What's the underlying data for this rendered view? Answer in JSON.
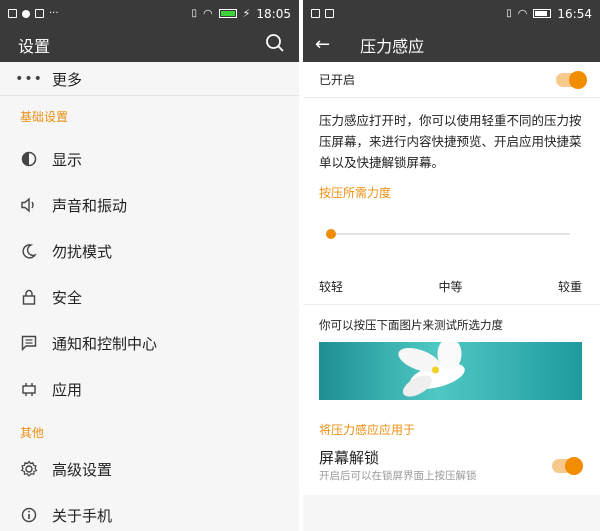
{
  "left": {
    "status": {
      "time": "18:05"
    },
    "appbar": {
      "title": "设置"
    },
    "items_top": [
      {
        "label": "更多",
        "icon": "more-icon"
      }
    ],
    "section_basic": "基础设置",
    "items_basic": [
      {
        "label": "显示",
        "icon": "display-icon"
      },
      {
        "label": "声音和振动",
        "icon": "sound-icon"
      },
      {
        "label": "勿扰模式",
        "icon": "moon-icon"
      },
      {
        "label": "安全",
        "icon": "lock-icon"
      },
      {
        "label": "通知和控制中心",
        "icon": "notification-icon"
      },
      {
        "label": "应用",
        "icon": "apps-icon"
      }
    ],
    "section_other": "其他",
    "items_other": [
      {
        "label": "高级设置",
        "icon": "gear-icon"
      },
      {
        "label": "关于手机",
        "icon": "info-icon"
      }
    ]
  },
  "right": {
    "status": {
      "time": "16:54"
    },
    "appbar": {
      "title": "压力感应"
    },
    "enabled_label": "已开启",
    "description": "压力感应打开时，你可以使用轻重不同的压力按压屏幕，来进行内容快捷预览、开启应用快捷菜单以及快捷解锁屏幕。",
    "force_section": "按压所需力度",
    "force_value": 0,
    "levels": [
      "较轻",
      "中等",
      "较重"
    ],
    "test_hint": "你可以按压下面图片来测试所选力度",
    "apply_section": "将压力感应应用于",
    "unlock": {
      "title": "屏幕解锁",
      "subtitle": "开启后可以在锁屏界面上按压解锁"
    }
  },
  "colors": {
    "accent": "#f28c00",
    "bar": "#3a3a3a",
    "battery_left": "#3ad43a"
  }
}
